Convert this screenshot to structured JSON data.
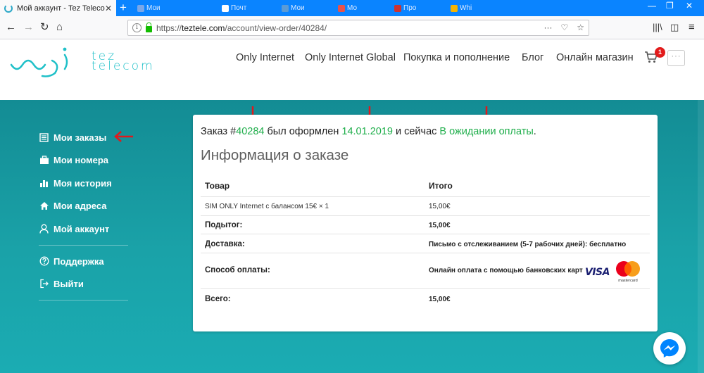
{
  "browser": {
    "tab_title": "Мой аккаунт - Tez Telecom",
    "url_base": "https://",
    "url_host": "teztele.com",
    "url_path": "/account/view-order/40284/",
    "bg_tabs": [
      "Мои",
      "Почт",
      "Мои",
      "Мо",
      "Про",
      "Whi"
    ]
  },
  "site": {
    "logo_line1": "tez",
    "logo_line2": "telecom",
    "nav": [
      "Only Internet",
      "Only Internet Global",
      "Покупка и пополнение",
      "Блог",
      "Онлайн магазин"
    ],
    "cart_count": "1",
    "more_label": "···"
  },
  "sidebar": {
    "items": [
      {
        "label": "Мои заказы",
        "icon": "list-icon"
      },
      {
        "label": "Мои номера",
        "icon": "briefcase-icon"
      },
      {
        "label": "Моя история",
        "icon": "bar-chart-icon"
      },
      {
        "label": "Мои адреса",
        "icon": "home-icon"
      },
      {
        "label": "Мой аккаунт",
        "icon": "user-icon"
      }
    ],
    "support": {
      "label": "Поддержка",
      "icon": "help-circle-icon"
    },
    "logout": {
      "label": "Выйти",
      "icon": "logout-icon"
    }
  },
  "order": {
    "prefix": "Заказ #",
    "number": "40284",
    "mid": " был оформлен ",
    "date": "14.01.2019",
    "mid2": " и сейчас ",
    "status": "В ожидании оплаты",
    "suffix": ".",
    "title": "Информация о заказе",
    "headers": {
      "product": "Товар",
      "total": "Итого"
    },
    "item": {
      "name": "SIM ONLY Internet с балансом 15€ × 1",
      "price": "15,00€"
    },
    "subtotal": {
      "label": "Подытог:",
      "value": "15,00€"
    },
    "shipping": {
      "label": "Доставка:",
      "value": "Письмо с отслеживанием (5-7 рабочих дней): бесплатно"
    },
    "payment": {
      "label": "Способ оплаты:",
      "value": "Онлайн оплата с помощью банковских карт",
      "visa": "VISA",
      "mastercard": "mastercard"
    },
    "total": {
      "label": "Всего:",
      "value": "15,00€"
    }
  },
  "colors": {
    "teal": "#1aa2a8",
    "green": "#1fae4b",
    "red_arrow": "#e0191c",
    "logo": "#1fc0c8"
  }
}
